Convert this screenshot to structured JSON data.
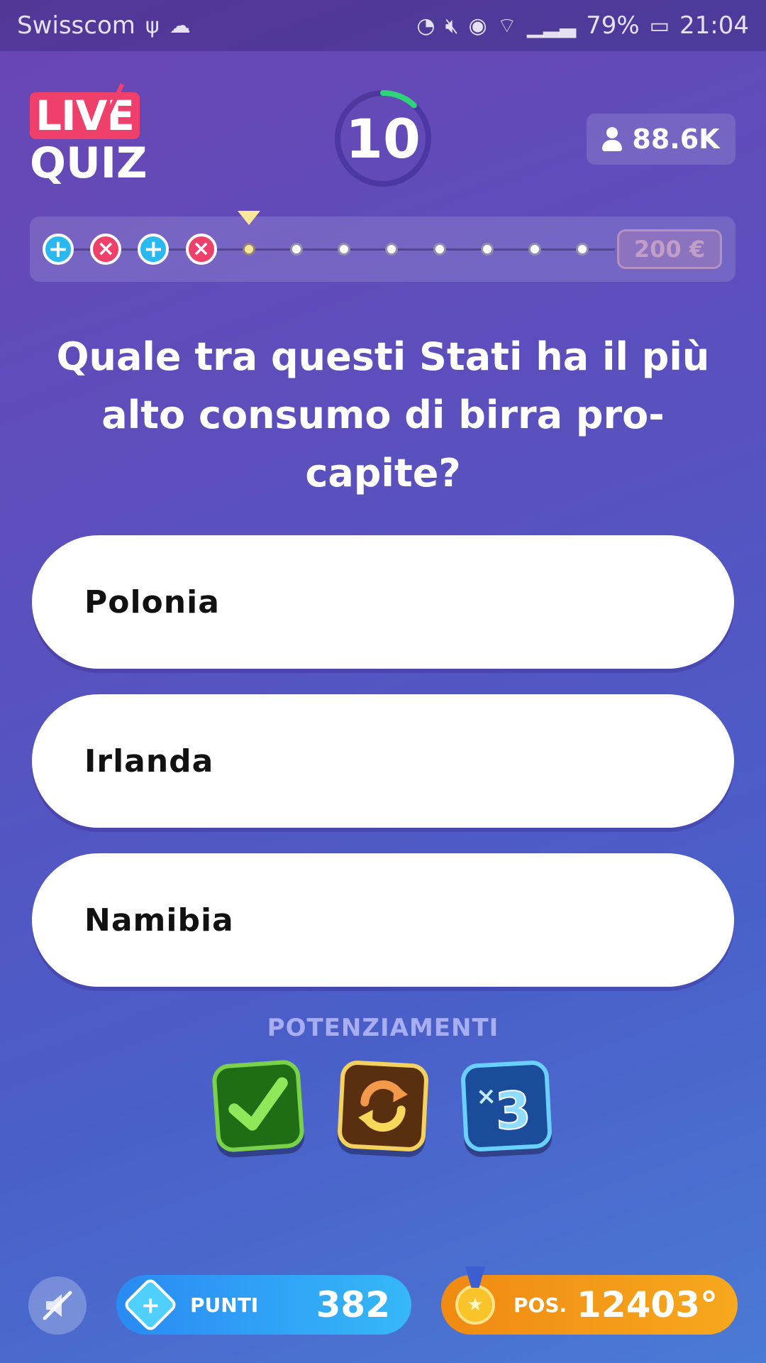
{
  "status_bar": {
    "carrier": "Swisscom",
    "battery": "79%",
    "time": "21:04",
    "icons": [
      "usb-icon",
      "cloud-icon",
      "data-saver-icon",
      "mute-icon",
      "eye-icon",
      "wifi-icon",
      "signal-icon",
      "battery-icon"
    ]
  },
  "header": {
    "logo_top": "LIVE",
    "logo_bottom": "QUIZ",
    "timer_value": "10",
    "timer_progress": 0.12,
    "viewers": "88.6K"
  },
  "progress": {
    "results": [
      "correct",
      "wrong",
      "correct",
      "wrong"
    ],
    "current_index": 4,
    "total_questions": 12,
    "prize": "200 €"
  },
  "question": {
    "text": "Quale tra questi Stati ha il più alto consumo di birra pro-capite?"
  },
  "answers": [
    {
      "label": "Polonia"
    },
    {
      "label": "Irlanda"
    },
    {
      "label": "Namibia"
    }
  ],
  "boosts": {
    "title": "POTENZIAMENTI",
    "items": [
      {
        "name": "check-boost",
        "glyph": "✔"
      },
      {
        "name": "swap-boost",
        "glyph": "⟳"
      },
      {
        "name": "times-three-boost",
        "glyph": "×3"
      }
    ]
  },
  "footer": {
    "punti_label": "PUNTI",
    "punti_value": "382",
    "pos_label": "POS.",
    "pos_value": "12403°"
  },
  "colors": {
    "accent_pink": "#ef3f6b",
    "accent_blue": "#2ab8f0",
    "accent_orange": "#f08a12",
    "timer_green": "#2fd37a",
    "pointer_yellow": "#fbe79a"
  }
}
